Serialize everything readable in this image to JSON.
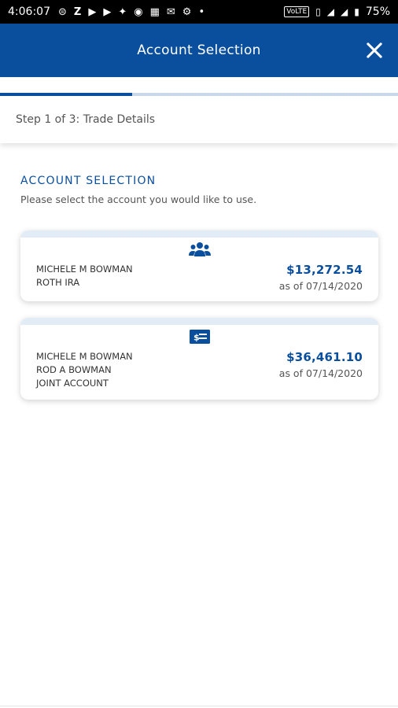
{
  "status_bar": {
    "time": "4:06:07",
    "left_icons": [
      "messenger-icon",
      "z-icon",
      "youtube-icon",
      "youtube-icon",
      "twitter-icon",
      "circle-icon",
      "qr-icon",
      "gmail-icon",
      "android-icon",
      "dot-icon"
    ],
    "volte": "VoLTE",
    "battery": "75%"
  },
  "header": {
    "title": "Account Selection"
  },
  "progress": {
    "fraction": 0.333
  },
  "step": {
    "label": "Step 1 of 3: Trade Details"
  },
  "section": {
    "title": "ACCOUNT SELECTION",
    "description": "Please select the account you would like to use."
  },
  "accounts": [
    {
      "icon": "people-group-icon",
      "names": [
        "MICHELE M BOWMAN",
        "ROTH IRA"
      ],
      "amount": "$13,272.54",
      "as_of": "as of 07/14/2020"
    },
    {
      "icon": "cash-icon",
      "names": [
        "MICHELE M BOWMAN",
        "ROD A BOWMAN",
        "JOINT ACCOUNT"
      ],
      "amount": "$36,461.10",
      "as_of": "as of 07/14/2020"
    }
  ],
  "colors": {
    "brand_blue": "#0a4f9e",
    "progress_track": "#c9d9ec",
    "card_top": "#e2ecf7"
  }
}
